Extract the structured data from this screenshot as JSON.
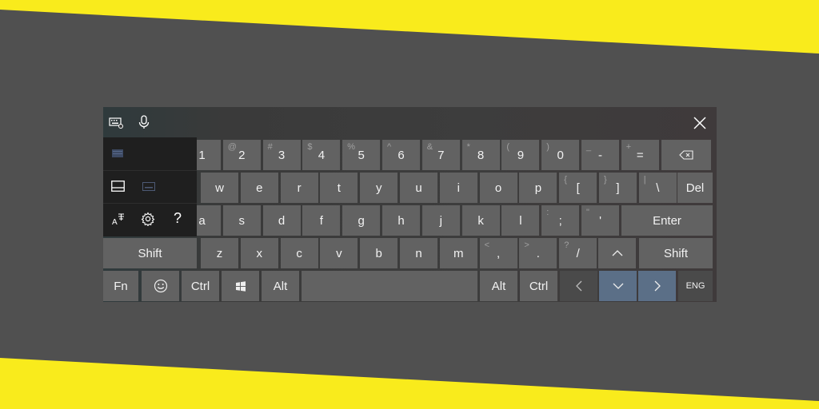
{
  "colors": {
    "accent_band": "#f9eb1c",
    "page_bg": "#505050",
    "key": "#626262",
    "key_dark": "#4a4a4a",
    "key_highlight": "#5b6f87",
    "panel": "#1f1f1f"
  },
  "toolbar": {
    "keyboard_icon": "keyboard-settings-icon",
    "mic_icon": "microphone-icon",
    "close_icon": "close-icon"
  },
  "panel": {
    "icons": [
      "full-keyboard-icon",
      "standard-keyboard-icon",
      "split-keyboard-icon",
      "text-prediction-icon",
      "settings-icon"
    ],
    "help_label": "?"
  },
  "rows": {
    "numbers": [
      {
        "primary": "1",
        "secondary": ""
      },
      {
        "primary": "2",
        "secondary": "@"
      },
      {
        "primary": "3",
        "secondary": "#"
      },
      {
        "primary": "4",
        "secondary": "$"
      },
      {
        "primary": "5",
        "secondary": "%"
      },
      {
        "primary": "6",
        "secondary": "^"
      },
      {
        "primary": "7",
        "secondary": "&"
      },
      {
        "primary": "8",
        "secondary": "*"
      },
      {
        "primary": "9",
        "secondary": "("
      },
      {
        "primary": "0",
        "secondary": ")"
      },
      {
        "primary": "-",
        "secondary": "_"
      },
      {
        "primary": "=",
        "secondary": "+"
      }
    ],
    "qwerty": [
      {
        "primary": "w",
        "secondary": ""
      },
      {
        "primary": "e",
        "secondary": ""
      },
      {
        "primary": "r",
        "secondary": ""
      },
      {
        "primary": "t",
        "secondary": ""
      },
      {
        "primary": "y",
        "secondary": ""
      },
      {
        "primary": "u",
        "secondary": ""
      },
      {
        "primary": "i",
        "secondary": ""
      },
      {
        "primary": "o",
        "secondary": ""
      },
      {
        "primary": "p",
        "secondary": ""
      },
      {
        "primary": "[",
        "secondary": "{"
      },
      {
        "primary": "]",
        "secondary": "}"
      },
      {
        "primary": "\\",
        "secondary": "|"
      }
    ],
    "home": [
      {
        "primary": "a",
        "secondary": ""
      },
      {
        "primary": "s",
        "secondary": ""
      },
      {
        "primary": "d",
        "secondary": ""
      },
      {
        "primary": "f",
        "secondary": ""
      },
      {
        "primary": "g",
        "secondary": ""
      },
      {
        "primary": "h",
        "secondary": ""
      },
      {
        "primary": "j",
        "secondary": ""
      },
      {
        "primary": "k",
        "secondary": ""
      },
      {
        "primary": "l",
        "secondary": ""
      },
      {
        "primary": ";",
        "secondary": ":"
      },
      {
        "primary": "'",
        "secondary": "\""
      }
    ],
    "bottom": [
      {
        "primary": "z",
        "secondary": ""
      },
      {
        "primary": "x",
        "secondary": ""
      },
      {
        "primary": "c",
        "secondary": ""
      },
      {
        "primary": "v",
        "secondary": ""
      },
      {
        "primary": "b",
        "secondary": ""
      },
      {
        "primary": "n",
        "secondary": ""
      },
      {
        "primary": "m",
        "secondary": ""
      },
      {
        "primary": ",",
        "secondary": "<"
      },
      {
        "primary": ".",
        "secondary": ">"
      },
      {
        "primary": "/",
        "secondary": "?"
      }
    ]
  },
  "keys": {
    "backspace_icon": "backspace-icon",
    "del": "Del",
    "enter": "Enter",
    "shift_left": "Shift",
    "shift_right": "Shift",
    "fn": "Fn",
    "emoji_icon": "emoji-icon",
    "ctrl_left": "Ctrl",
    "windows_icon": "windows-icon",
    "alt_left": "Alt",
    "alt_right": "Alt",
    "ctrl_right": "Ctrl",
    "lang": "ENG",
    "up_icon": "arrow-up-icon",
    "left_icon": "arrow-left-icon",
    "down_icon": "arrow-down-icon",
    "right_icon": "arrow-right-icon"
  }
}
